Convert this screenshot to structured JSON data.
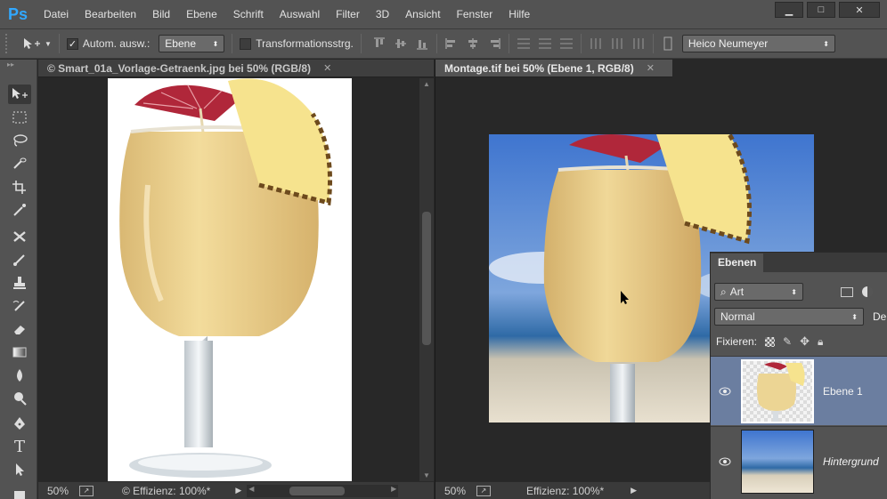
{
  "app": {
    "logo": "Ps"
  },
  "menu": [
    "Datei",
    "Bearbeiten",
    "Bild",
    "Ebene",
    "Schrift",
    "Auswahl",
    "Filter",
    "3D",
    "Ansicht",
    "Fenster",
    "Hilfe"
  ],
  "options": {
    "auto_select_label": "Autom. ausw.:",
    "auto_select_value": "Ebene",
    "transform_label": "Transformationsstrg.",
    "workspace_value": "Heico Neumeyer"
  },
  "docs": [
    {
      "title": "© Smart_01a_Vorlage-Getraenk.jpg bei 50% (RGB/8)",
      "zoom": "50%",
      "status": "© Effizienz: 100%*"
    },
    {
      "title": "Montage.tif bei 50% (Ebene 1, RGB/8)",
      "zoom": "50%",
      "status": "Effizienz: 100%*"
    }
  ],
  "layers_panel": {
    "tab": "Ebenen",
    "filter_value": "Art",
    "blend_mode": "Normal",
    "opacity_label_partial": "De",
    "lock_label": "Fixieren:",
    "layers": [
      {
        "name": "Ebene 1",
        "selected": true,
        "italic": false
      },
      {
        "name": "Hintergrund",
        "selected": false,
        "italic": true
      }
    ]
  },
  "colors": {
    "accent_blue": "#31a8ff",
    "selection": "#6b7ea0",
    "panel": "#535353",
    "canvas_bg": "#282828"
  }
}
